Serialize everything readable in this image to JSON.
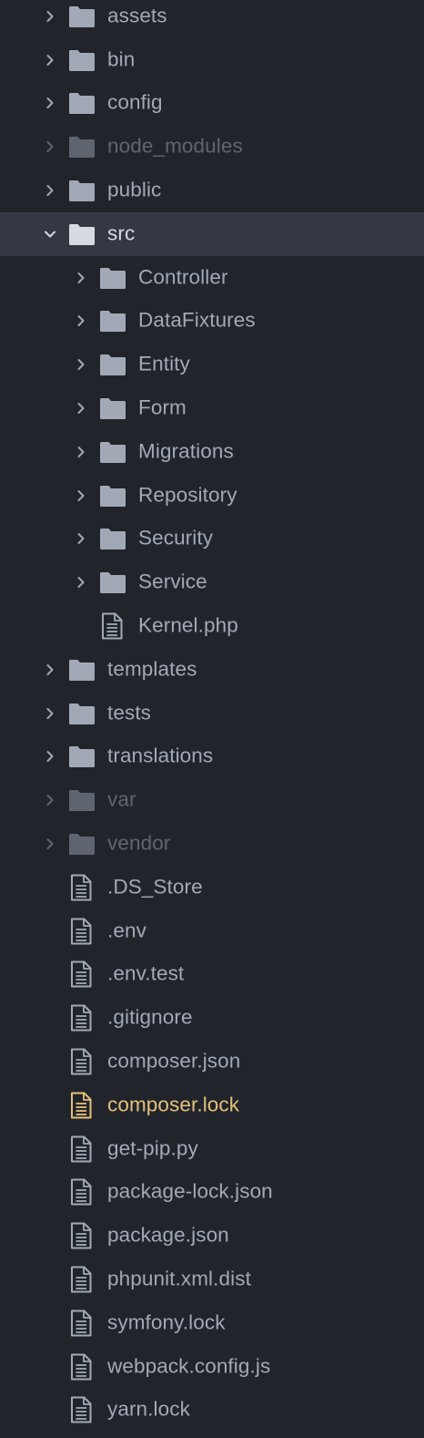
{
  "colors": {
    "background": "#21252b",
    "selected_row": "#333842",
    "text": "#a2a9b6",
    "text_selected": "#d7dae0",
    "text_ignored": "#5f6570",
    "text_modified": "#e5c07b",
    "folder": "#a2a9b6",
    "folder_ignored": "#5f6570"
  },
  "tree": {
    "items": [
      {
        "label": "assets",
        "type": "folder",
        "icon": "folder-icon",
        "state": "collapsed"
      },
      {
        "label": "bin",
        "type": "folder",
        "icon": "folder-icon",
        "state": "collapsed"
      },
      {
        "label": "config",
        "type": "folder",
        "icon": "folder-icon",
        "state": "collapsed"
      },
      {
        "label": "node_modules",
        "type": "folder",
        "icon": "folder-icon",
        "state": "collapsed",
        "ignored": true
      },
      {
        "label": "public",
        "type": "folder",
        "icon": "folder-icon",
        "state": "collapsed"
      },
      {
        "label": "src",
        "type": "folder",
        "icon": "folder-open-icon",
        "state": "expanded",
        "selected": true,
        "children": [
          {
            "label": "Controller",
            "type": "folder",
            "icon": "folder-icon",
            "state": "collapsed"
          },
          {
            "label": "DataFixtures",
            "type": "folder",
            "icon": "folder-icon",
            "state": "collapsed"
          },
          {
            "label": "Entity",
            "type": "folder",
            "icon": "folder-icon",
            "state": "collapsed"
          },
          {
            "label": "Form",
            "type": "folder",
            "icon": "folder-icon",
            "state": "collapsed"
          },
          {
            "label": "Migrations",
            "type": "folder",
            "icon": "folder-icon",
            "state": "collapsed"
          },
          {
            "label": "Repository",
            "type": "folder",
            "icon": "folder-icon",
            "state": "collapsed"
          },
          {
            "label": "Security",
            "type": "folder",
            "icon": "folder-icon",
            "state": "collapsed"
          },
          {
            "label": "Service",
            "type": "folder",
            "icon": "folder-icon",
            "state": "collapsed"
          },
          {
            "label": "Kernel.php",
            "type": "file",
            "icon": "file-text-icon"
          }
        ]
      },
      {
        "label": "templates",
        "type": "folder",
        "icon": "folder-icon",
        "state": "collapsed"
      },
      {
        "label": "tests",
        "type": "folder",
        "icon": "folder-icon",
        "state": "collapsed"
      },
      {
        "label": "translations",
        "type": "folder",
        "icon": "folder-icon",
        "state": "collapsed"
      },
      {
        "label": "var",
        "type": "folder",
        "icon": "folder-icon",
        "state": "collapsed",
        "ignored": true
      },
      {
        "label": "vendor",
        "type": "folder",
        "icon": "folder-icon",
        "state": "collapsed",
        "ignored": true
      },
      {
        "label": ".DS_Store",
        "type": "file",
        "icon": "file-text-icon"
      },
      {
        "label": ".env",
        "type": "file",
        "icon": "file-text-icon"
      },
      {
        "label": ".env.test",
        "type": "file",
        "icon": "file-text-icon"
      },
      {
        "label": ".gitignore",
        "type": "file",
        "icon": "file-text-icon"
      },
      {
        "label": "composer.json",
        "type": "file",
        "icon": "file-text-icon"
      },
      {
        "label": "composer.lock",
        "type": "file",
        "icon": "file-text-icon",
        "modified": true
      },
      {
        "label": "get-pip.py",
        "type": "file",
        "icon": "file-text-icon"
      },
      {
        "label": "package-lock.json",
        "type": "file",
        "icon": "file-text-icon"
      },
      {
        "label": "package.json",
        "type": "file",
        "icon": "file-text-icon"
      },
      {
        "label": "phpunit.xml.dist",
        "type": "file",
        "icon": "file-text-icon"
      },
      {
        "label": "symfony.lock",
        "type": "file",
        "icon": "file-text-icon"
      },
      {
        "label": "webpack.config.js",
        "type": "file",
        "icon": "file-text-icon"
      },
      {
        "label": "yarn.lock",
        "type": "file",
        "icon": "file-text-icon"
      }
    ]
  }
}
